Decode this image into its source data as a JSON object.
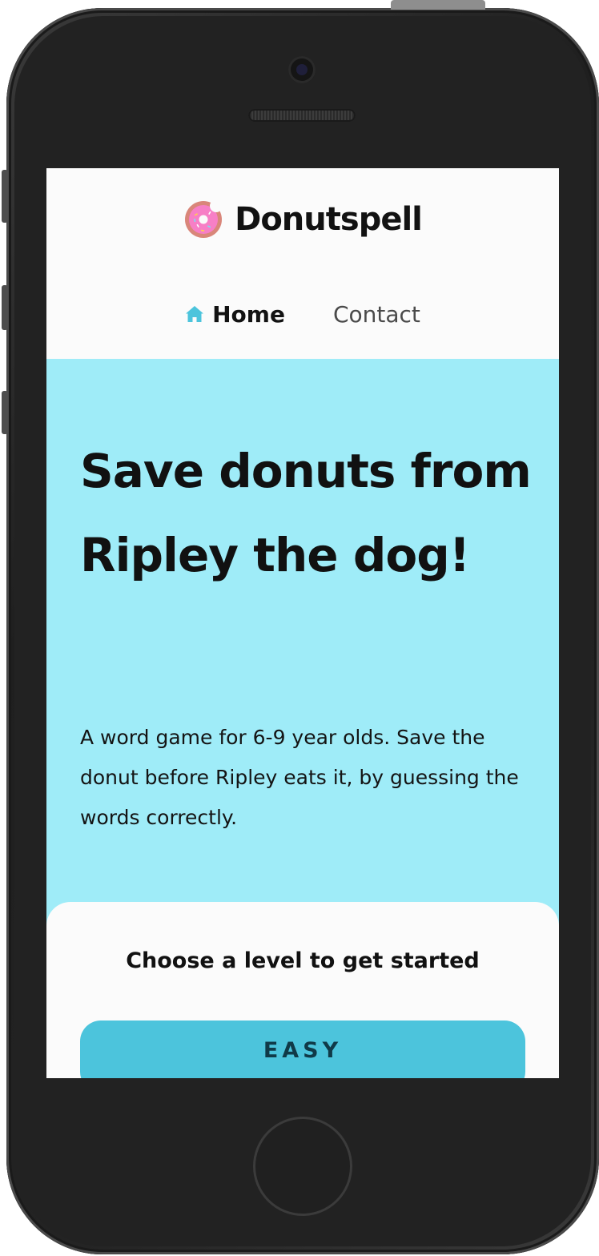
{
  "header": {
    "brand_name": "Donutspell",
    "logo_icon": "donut-icon"
  },
  "nav": {
    "items": [
      {
        "label": "Home",
        "icon": "house-icon",
        "active": true
      },
      {
        "label": "Contact",
        "active": false
      }
    ]
  },
  "hero": {
    "title": "Save donuts from Ripley the dog!",
    "description": "A word game for 6-9 year olds. Save the donut before Ripley eats it, by guessing the words correctly."
  },
  "levels": {
    "heading": "Choose a level to get started",
    "buttons": [
      {
        "label": "EASY"
      }
    ]
  },
  "colors": {
    "hero_background": "#9fecf8",
    "button_background": "#4cc4dc",
    "header_background": "#fbfbfb",
    "text": "#111111"
  }
}
